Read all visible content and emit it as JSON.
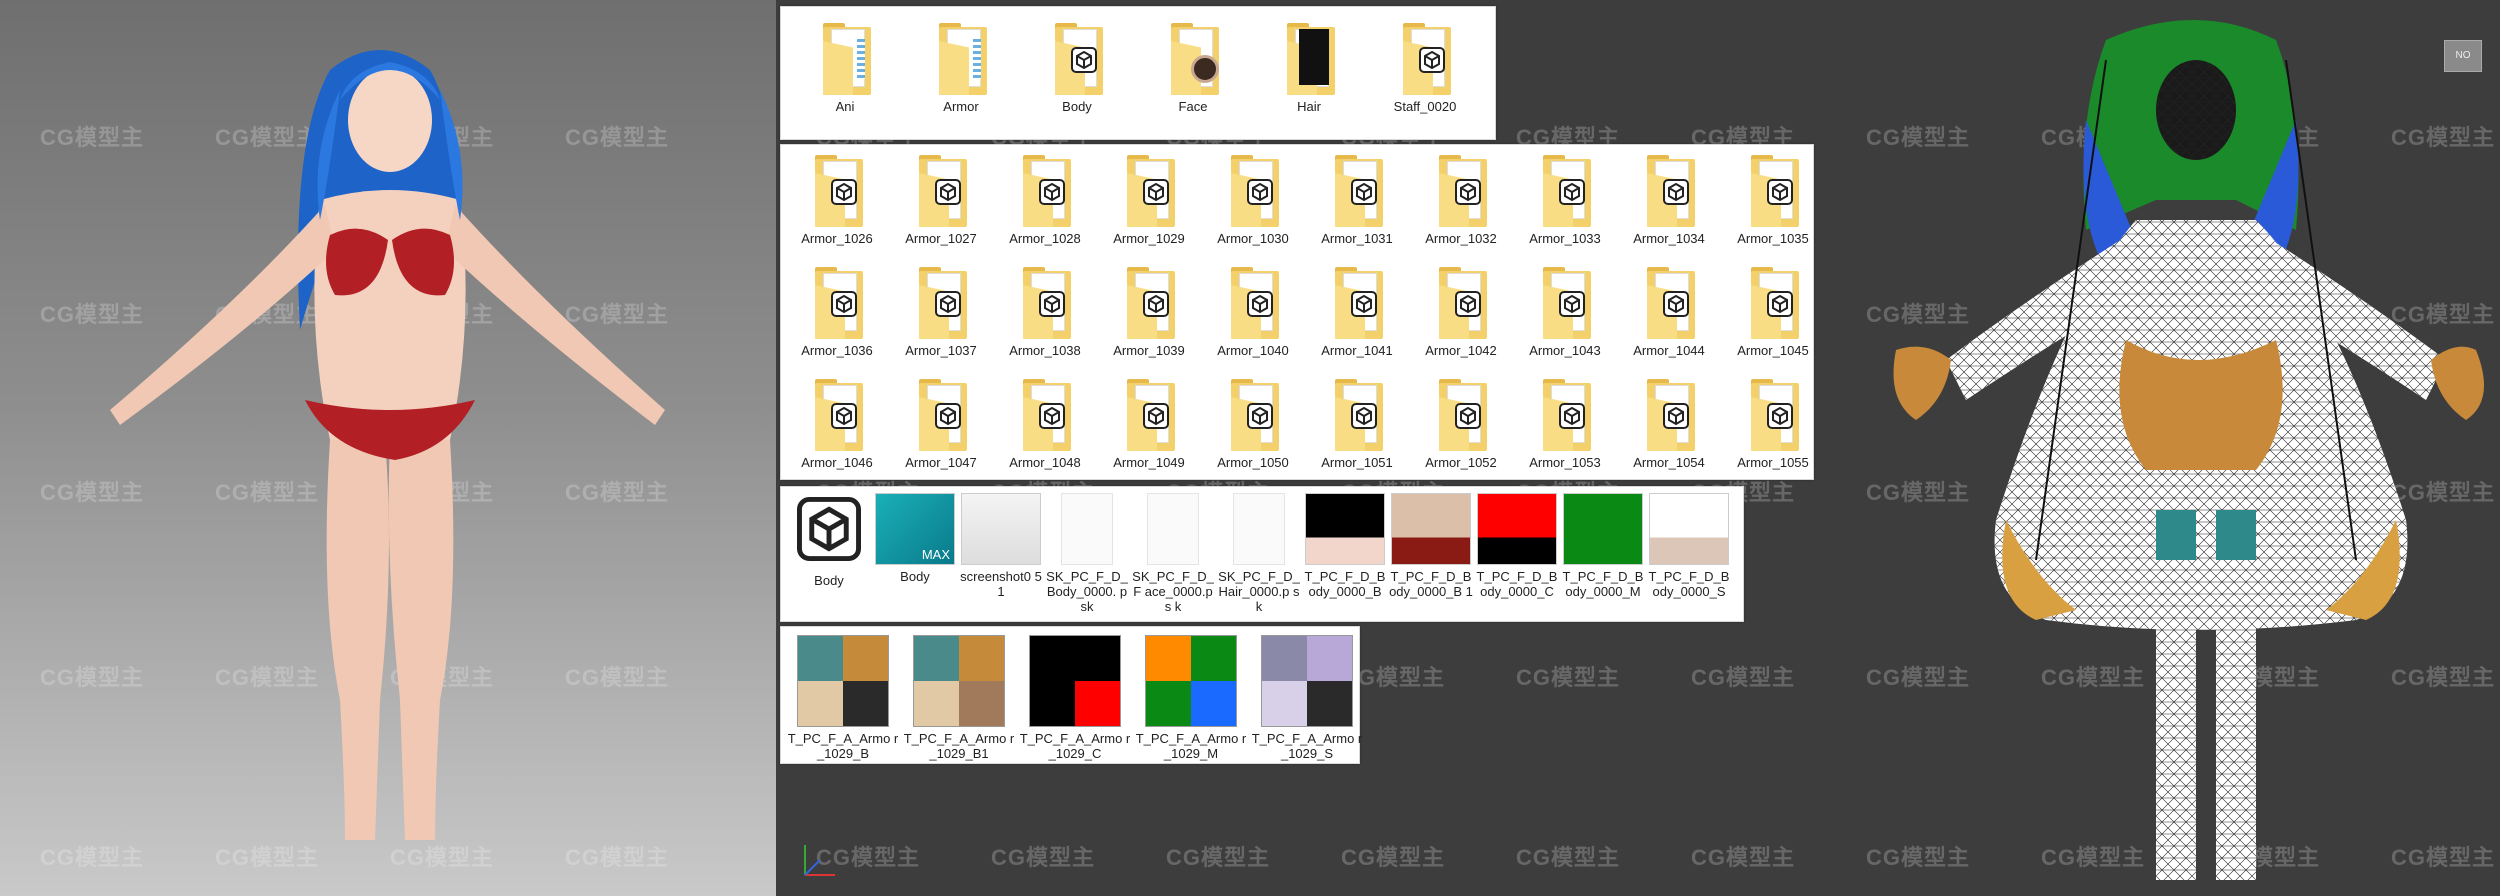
{
  "watermark": "CG模型主",
  "folders_row": [
    {
      "label": "Ani",
      "icon": "document-folder-icon"
    },
    {
      "label": "Armor",
      "icon": "document-folder-icon"
    },
    {
      "label": "Body",
      "icon": "model-folder-icon"
    },
    {
      "label": "Face",
      "icon": "face-folder-icon"
    },
    {
      "label": "Hair",
      "icon": "hair-folder-icon"
    },
    {
      "label": "Staff_0020",
      "icon": "model-folder-icon"
    }
  ],
  "armor_folders": [
    "Armor_1026",
    "Armor_1027",
    "Armor_1028",
    "Armor_1029",
    "Armor_1030",
    "Armor_1031",
    "Armor_1032",
    "Armor_1033",
    "Armor_1034",
    "Armor_1035",
    "Armor_1036",
    "Armor_1037",
    "Armor_1038",
    "Armor_1039",
    "Armor_1040",
    "Armor_1041",
    "Armor_1042",
    "Armor_1043",
    "Armor_1044",
    "Armor_1045",
    "Armor_1046",
    "Armor_1047",
    "Armor_1048",
    "Armor_1049",
    "Armor_1050",
    "Armor_1051",
    "Armor_1052",
    "Armor_1053",
    "Armor_1054",
    "Armor_1055"
  ],
  "body_files": [
    {
      "label": "Body",
      "icon": "model-file-icon"
    },
    {
      "label": "Body",
      "icon": "3dsmax-file-icon",
      "badge": "MAX"
    },
    {
      "label": "screenshot0 51",
      "icon": "screenshot-thumbnail-icon"
    },
    {
      "label": "SK_PC_F_D_ Body_0000. psk",
      "icon": "blank-file-icon"
    },
    {
      "label": "SK_PC_F_D_F ace_0000.ps k",
      "icon": "blank-file-icon"
    },
    {
      "label": "SK_PC_F_D_ Hair_0000.p sk",
      "icon": "blank-file-icon"
    },
    {
      "label": "T_PC_F_D_B ody_0000_B",
      "icon": "texture-thumbnail-icon",
      "colors": [
        "#000000",
        "#f2d6cc"
      ]
    },
    {
      "label": "T_PC_F_D_B ody_0000_B 1",
      "icon": "texture-thumbnail-icon",
      "colors": [
        "#dcbfa8",
        "#8a1a14"
      ]
    },
    {
      "label": "T_PC_F_D_B ody_0000_C",
      "icon": "texture-thumbnail-icon",
      "colors": [
        "#ff0000",
        "#000000"
      ]
    },
    {
      "label": "T_PC_F_D_B ody_0000_M",
      "icon": "texture-thumbnail-icon",
      "colors": [
        "#0a8a14",
        "#0a8a14"
      ]
    },
    {
      "label": "T_PC_F_D_B ody_0000_S",
      "icon": "texture-thumbnail-icon",
      "colors": [
        "#ffffff",
        "#dcc6b8"
      ]
    }
  ],
  "armor_textures": [
    {
      "label": "T_PC_F_A_Armo r_1029_B",
      "colors": [
        "#c58a3a",
        "#2a2a2a",
        "#e0c9a4",
        "#4a8a8a"
      ]
    },
    {
      "label": "T_PC_F_A_Armo r_1029_B1",
      "colors": [
        "#c58a3a",
        "#a07a5a",
        "#e0c9a4",
        "#4a8a8a"
      ]
    },
    {
      "label": "T_PC_F_A_Armo r_1029_C",
      "colors": [
        "#000000",
        "#ff0000",
        "#000000",
        "#000000"
      ]
    },
    {
      "label": "T_PC_F_A_Armo r_1029_M",
      "colors": [
        "#0a8a14",
        "#1a6aff",
        "#0a8a14",
        "#ff8a00"
      ]
    },
    {
      "label": "T_PC_F_A_Armo r_1029_S",
      "colors": [
        "#b8a8d8",
        "#2a2a2a",
        "#d8d0e8",
        "#8a8aa8"
      ]
    }
  ],
  "viewport_corner_label": "NO"
}
